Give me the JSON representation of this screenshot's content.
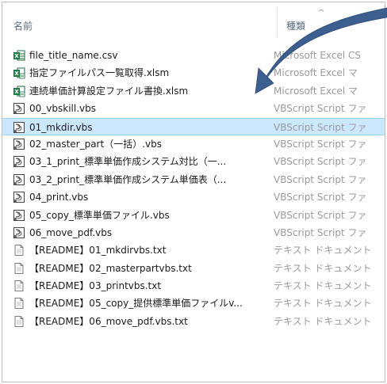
{
  "header": {
    "name_column": "名前",
    "type_column": "種類",
    "sort_glyph": "^"
  },
  "files": [
    {
      "name": "file_title_name.csv",
      "type": "Microsoft Excel CS",
      "icon": "excel-csv-icon"
    },
    {
      "name": "指定ファイルパス一覧取得.xlsm",
      "type": "Microsoft Excel マ",
      "icon": "excel-macro-icon"
    },
    {
      "name": "連続単価計算設定ファイル書換.xlsm",
      "type": "Microsoft Excel マ",
      "icon": "excel-macro-icon"
    },
    {
      "name": "00_vbskill.vbs",
      "type": "VBScript Script ファ",
      "icon": "vbscript-icon"
    },
    {
      "name": "01_mkdir.vbs",
      "type": "VBScript Script ファ",
      "icon": "vbscript-icon",
      "selected": true
    },
    {
      "name": "02_master_part（一括）.vbs",
      "type": "VBScript Script ファ",
      "icon": "vbscript-icon"
    },
    {
      "name": "03_1_print_標準単価作成システム対比（一...",
      "type": "VBScript Script ファ",
      "icon": "vbscript-icon"
    },
    {
      "name": "03_2_print_標準単価作成システム単価表（...",
      "type": "VBScript Script ファ",
      "icon": "vbscript-icon"
    },
    {
      "name": "04_print.vbs",
      "type": "VBScript Script ファ",
      "icon": "vbscript-icon"
    },
    {
      "name": "05_copy_標準単価ファイル.vbs",
      "type": "VBScript Script ファ",
      "icon": "vbscript-icon"
    },
    {
      "name": "06_move_pdf.vbs",
      "type": "VBScript Script ファ",
      "icon": "vbscript-icon"
    },
    {
      "name": "【README】01_mkdirvbs.txt",
      "type": "テキスト ドキュメント",
      "icon": "text-document-icon"
    },
    {
      "name": "【README】02_masterpartvbs.txt",
      "type": "テキスト ドキュメント",
      "icon": "text-document-icon"
    },
    {
      "name": "【README】03_printvbs.txt",
      "type": "テキスト ドキュメント",
      "icon": "text-document-icon"
    },
    {
      "name": "【README】05_copy_提供標準単価ファイルv...",
      "type": "テキスト ドキュメント",
      "icon": "text-document-icon"
    },
    {
      "name": "【README】06_move_pdf.vbs.txt",
      "type": "テキスト ドキュメント",
      "icon": "text-document-icon"
    }
  ],
  "colors": {
    "selection_bg": "#cce8ff",
    "selection_border": "#99d1ff",
    "header_text": "#5a6b7d",
    "type_text": "#9a9a9a",
    "callout_arrow": "#3d5f8f"
  }
}
